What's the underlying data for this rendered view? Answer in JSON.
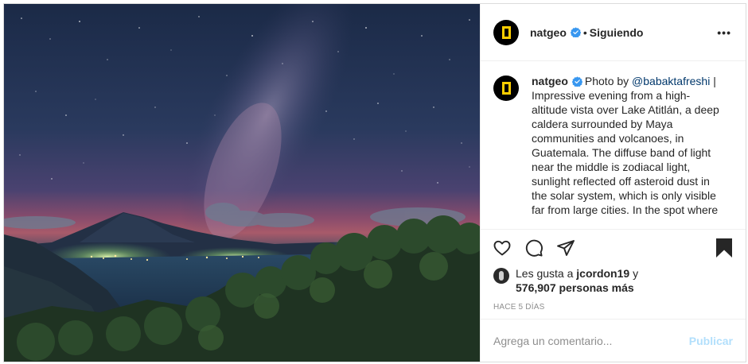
{
  "post": {
    "photo_alt": "",
    "author": {
      "username": "natgeo",
      "verified": true,
      "separator": "•",
      "follow_status": "Siguiendo",
      "more_label": "•••"
    },
    "caption": {
      "username": "natgeo",
      "prefix": "Photo by ",
      "mention": "@babaktafreshi",
      "separator_after_mention": " |",
      "text": "Impressive evening from a high-altitude vista over Lake Atitlán, a deep caldera surrounded by Maya communities and volcanoes, in Guatemala. The diffuse band of light near the middle is zodiacal light, sunlight reflected off asteroid dust in the solar system, which is only visible far from large cities. In the spot where"
    },
    "actions": {
      "like_icon": "heart-icon",
      "comment_icon": "comment-icon",
      "share_icon": "paper-plane-icon",
      "save_icon": "bookmark-icon"
    },
    "likes": {
      "prefix": "Les gusta a ",
      "liker": "jcordon19",
      "connector": " y",
      "count_text": "576,907 personas más"
    },
    "timestamp": "Hace 5 días",
    "comment_box": {
      "placeholder": "Agrega un comentario...",
      "value": "",
      "publish_label": "Publicar"
    },
    "colors": {
      "verified_blue": "#3897f0",
      "link_blue": "#00376b",
      "publish_disabled": "#b2dffc",
      "natgeo_yellow": "#ffce00"
    }
  }
}
